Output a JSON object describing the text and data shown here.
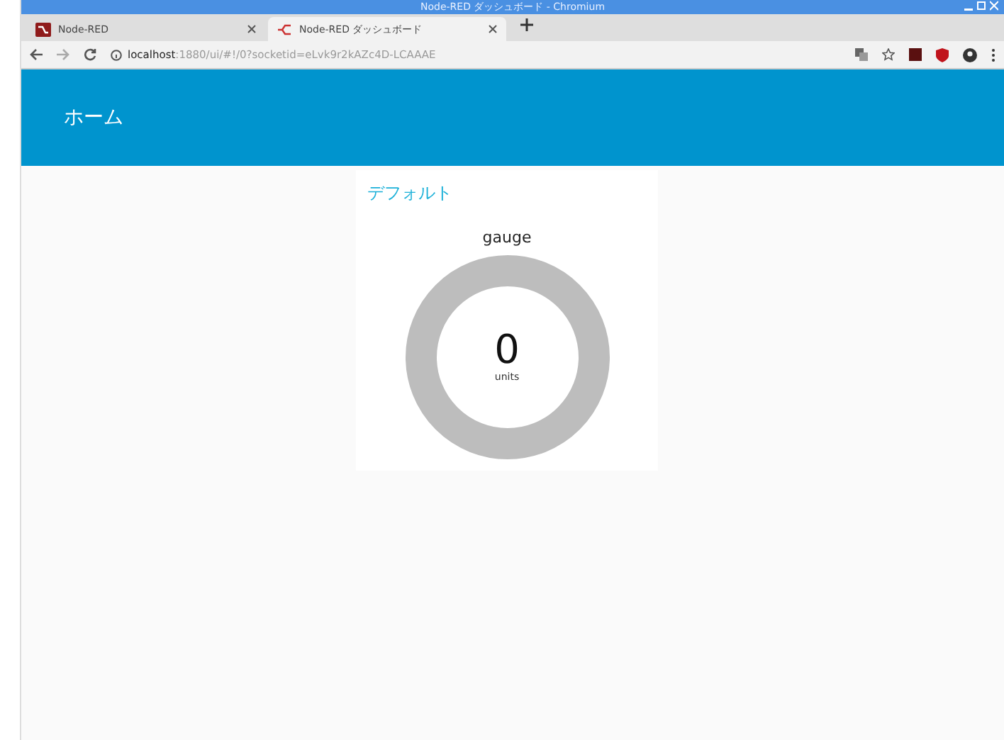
{
  "window": {
    "title": "Node-RED ダッシュボード - Chromium"
  },
  "tabs": [
    {
      "label": "Node-RED",
      "selected": false,
      "kind": "nodered"
    },
    {
      "label": "Node-RED ダッシュボード",
      "selected": true,
      "kind": "dashboard"
    }
  ],
  "address_bar": {
    "host": "localhost",
    "path": ":1880/ui/#!/0?socketid=eLvk9r2kAZc4D-LCAAAE"
  },
  "header": {
    "title": "ホーム"
  },
  "group": {
    "title": "デフォルト",
    "gauge": {
      "label": "gauge",
      "value": "0",
      "units": "units"
    }
  }
}
